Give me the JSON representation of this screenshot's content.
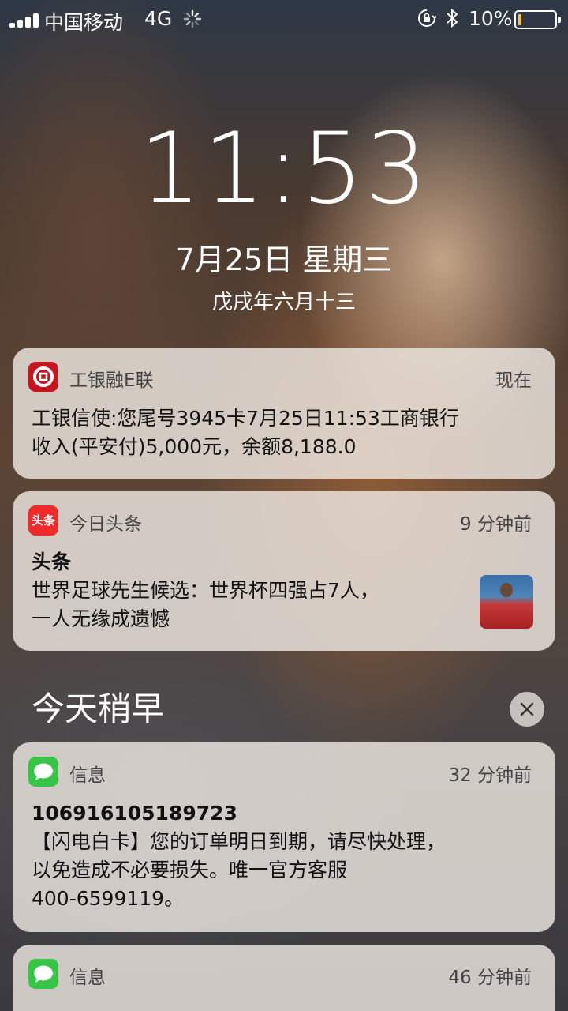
{
  "status": {
    "carrier": "中国移动",
    "network": "4G",
    "battery_pct": "10%",
    "battery_level": 0.1
  },
  "clock": {
    "time": "11:53",
    "date": "7月25日 星期三",
    "lunar": "戊戌年六月十三"
  },
  "notifications": [
    {
      "app": "工银融E联",
      "ago": "现在",
      "title": "",
      "lines": [
        "工银信使:您尾号3945卡7月25日11:53工商银行",
        "收入(平安付)5,000元，余额8,188.0"
      ],
      "icon": "icbc-icon"
    },
    {
      "app": "今日头条",
      "icon_text": "头条",
      "ago": "9 分钟前",
      "title": "头条",
      "lines": [
        "世界足球先生候选：世界杯四强占7人，",
        "一人无缘成遗憾"
      ],
      "icon": "toutiao-icon"
    }
  ],
  "earlier": {
    "heading": "今天稍早",
    "items": [
      {
        "app": "信息",
        "ago": "32 分钟前",
        "title": "10691610518972​3",
        "lines": [
          "【闪电白卡】您的订单明日到期，请尽快处理，",
          "以免造成不必要损失。唯一官方客服",
          "400-6599119。"
        ],
        "icon": "messages-icon"
      },
      {
        "app": "信息",
        "ago": "46 分钟前",
        "title": "",
        "lines": [],
        "icon": "messages-icon"
      }
    ]
  }
}
